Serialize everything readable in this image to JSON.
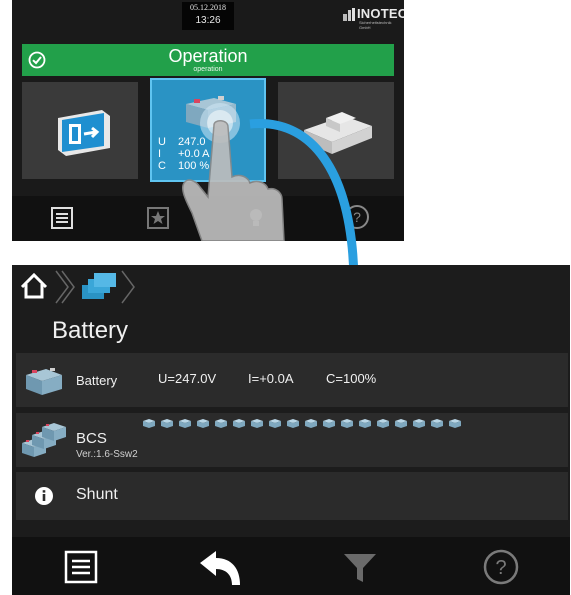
{
  "top_panel": {
    "date": "05.12.2018",
    "time": "13:26",
    "logo": "INOTEC",
    "logo_sub": "Sicherheitstechnik GmbH",
    "status_title": "Operation",
    "status_sub": "operation",
    "status_color": "#22a04a",
    "battery_tile": {
      "u_key": "U",
      "u_val": "247.0",
      "i_key": "I",
      "i_val": "+0.0  A",
      "c_key": "C",
      "c_val": "100  %"
    },
    "tiles": [
      "exit-sign-icon",
      "battery-icon",
      "modules-icon"
    ],
    "toolbar_icons": [
      "list-icon",
      "star-icon",
      "bulb-icon",
      "help-icon"
    ]
  },
  "bottom_panel": {
    "page_title": "Battery",
    "breadcrumb_icons": [
      "home-icon",
      "batteries-icon"
    ],
    "rows": [
      {
        "label": "Battery",
        "u": "U=247.0V",
        "i": "I=+0.0A",
        "c": "C=100%"
      },
      {
        "label": "BCS",
        "version": "Ver.:1.6-Ssw2"
      },
      {
        "label": "Shunt"
      }
    ],
    "bcs_units": 18,
    "toolbar_icons": [
      "list-icon",
      "back-icon",
      "filter-icon",
      "help-icon"
    ],
    "accent": "#2a93c4"
  }
}
